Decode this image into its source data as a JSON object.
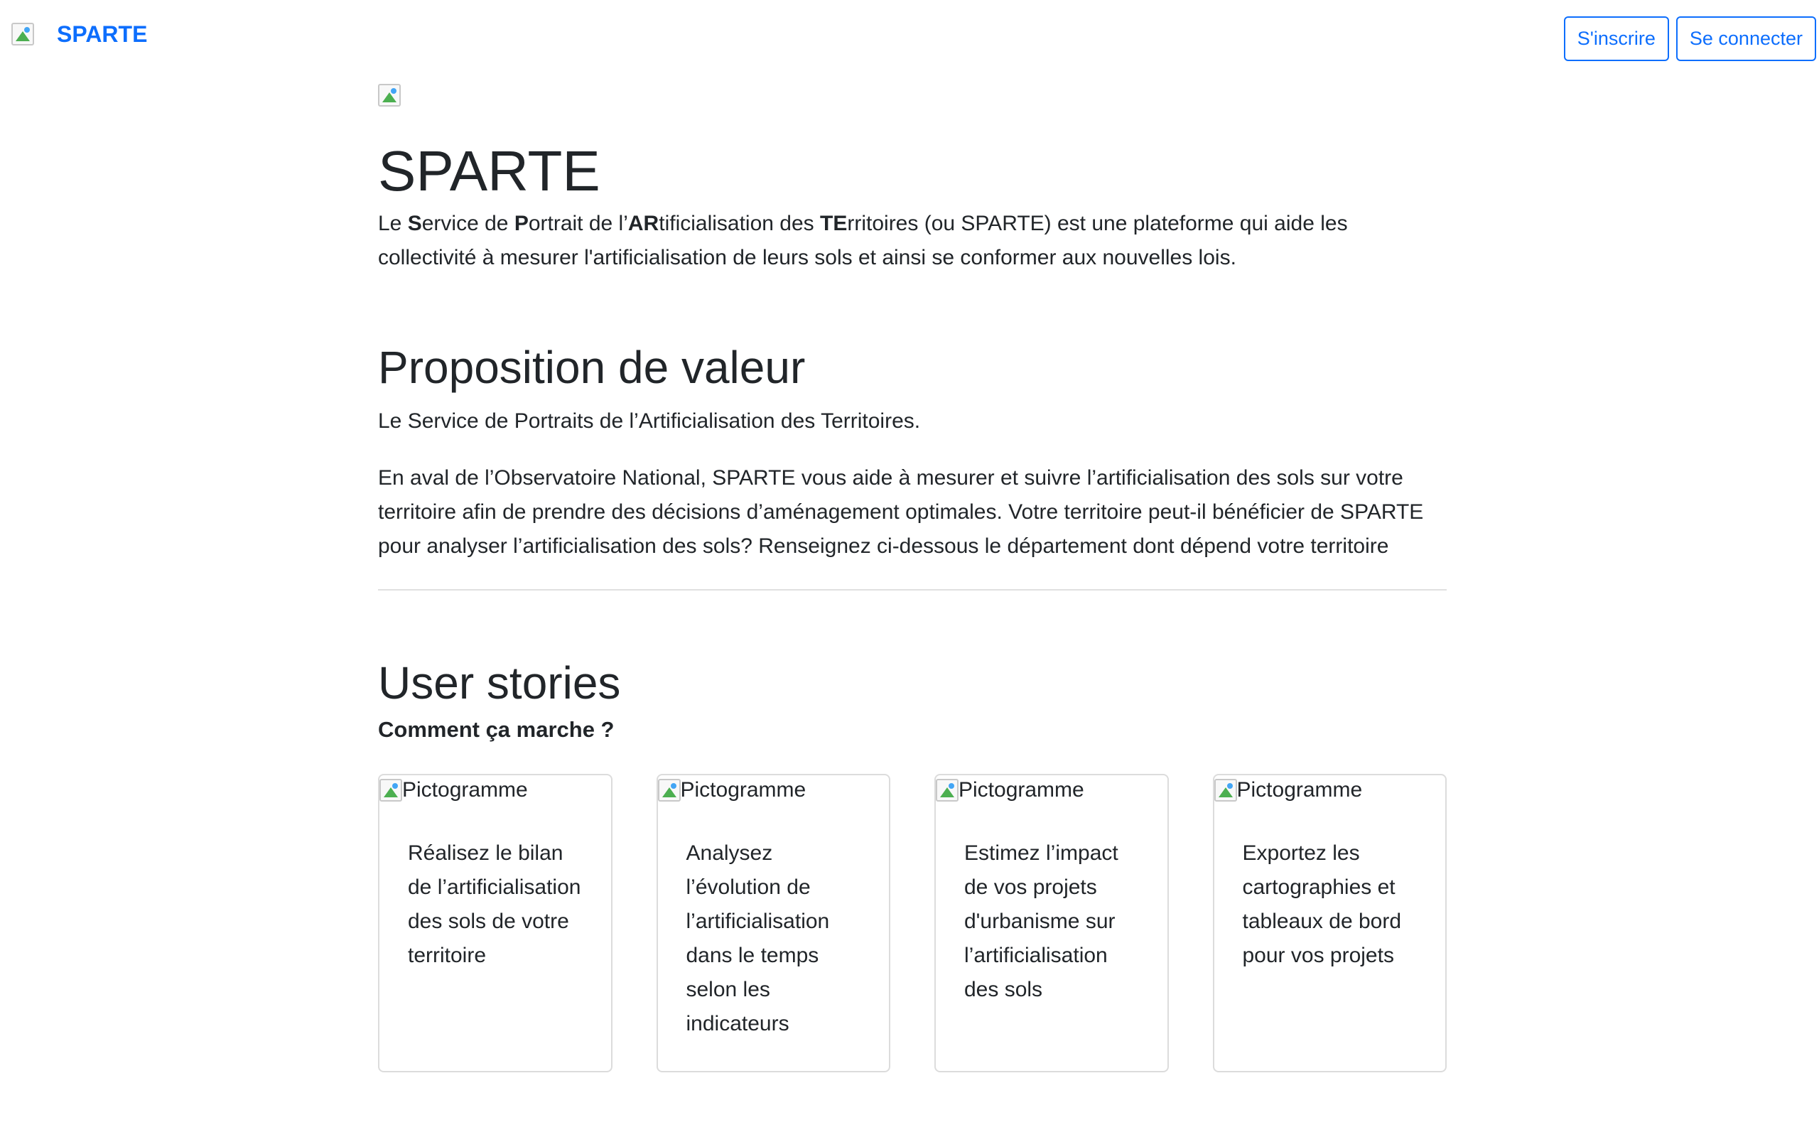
{
  "navbar": {
    "brand_logo_icon": "broken-image-icon",
    "brand_name": "SPARTE",
    "signup_label": "S'inscrire",
    "login_label": "Se connecter",
    "accent_color": "#0d6efd"
  },
  "hero": {
    "image_icon": "broken-image-icon",
    "title": "SPARTE",
    "lead": {
      "p1": "Le ",
      "b1": "S",
      "p2": "ervice de ",
      "b2": "P",
      "p3": "ortrait de l’",
      "b3": "AR",
      "p4": "tificialisation des ",
      "b4": "TE",
      "p5": "rritoires (ou SPARTE) est une plateforme qui aide les collectivité à mesurer l'artificialisation de leurs sols et ainsi se conformer aux nouvelles lois."
    }
  },
  "value": {
    "title": "Proposition de valeur",
    "subtitle": "Le Service de Portraits de l’Artificialisation des Territoires.",
    "description": "En aval de l’Observatoire National, SPARTE vous aide à mesurer et suivre l’artificialisation des sols sur votre territoire afin de prendre des décisions d’aménagement optimales. Votre territoire peut-il bénéficier de SPARTE pour analyser l’artificialisation des sols? Renseignez ci-dessous le département dont dépend votre territoire"
  },
  "stories": {
    "title": "User stories",
    "subtitle": "Comment ça marche ?",
    "cards": [
      {
        "img_alt": "Pictogramme",
        "text": "Réalisez le bilan de l’artificialisation des sols de votre territoire"
      },
      {
        "img_alt": "Pictogramme",
        "text": "Analysez l’évolution de l’artificialisation dans le temps selon les indicateurs"
      },
      {
        "img_alt": "Pictogramme",
        "text": "Estimez l’impact de vos projets d'urbanisme sur l’artificialisation des sols"
      },
      {
        "img_alt": "Pictogramme",
        "text": "Exportez les cartographies et tableaux de bord pour vos projets"
      }
    ]
  }
}
